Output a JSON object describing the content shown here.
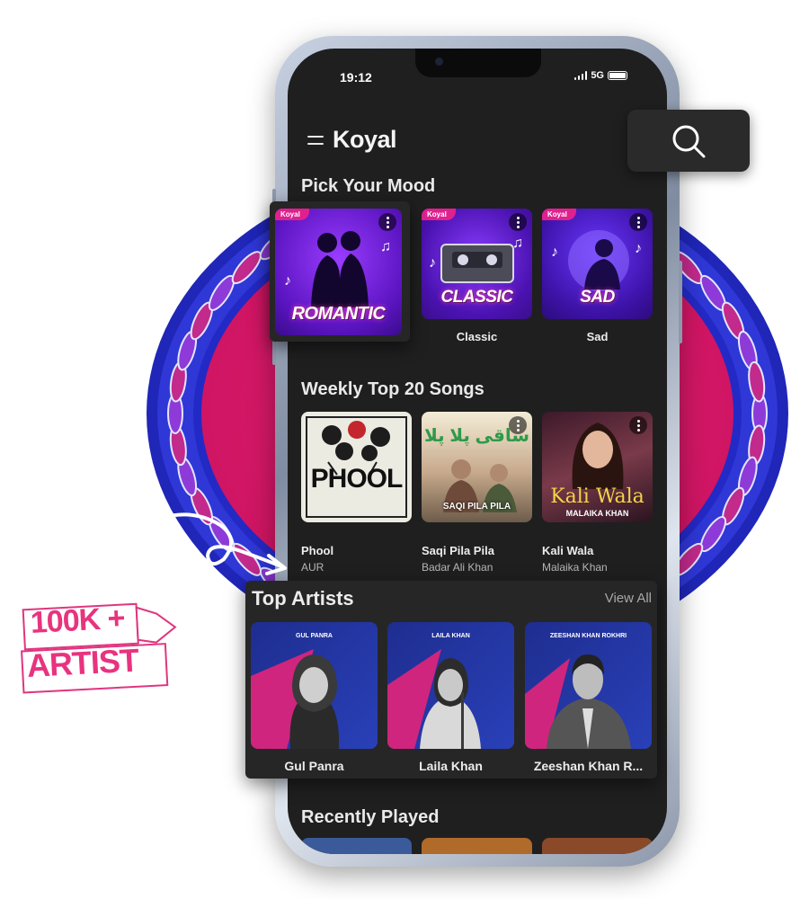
{
  "status_bar": {
    "time": "19:12",
    "network": "5G"
  },
  "app": {
    "brand": "Koyal",
    "tag": "Koyal"
  },
  "mood": {
    "title": "Pick Your Mood",
    "items": [
      {
        "art_text": "ROMANTIC",
        "label": ""
      },
      {
        "art_text": "CLASSIC",
        "label": "Classic"
      },
      {
        "art_text": "SAD",
        "label": "Sad"
      }
    ]
  },
  "weekly": {
    "title": "Weekly Top 20 Songs",
    "songs": [
      {
        "art_text": "PHOOL",
        "title": "Phool",
        "artist": "AUR"
      },
      {
        "art_text": "ساقی پلا پلا",
        "art_sub": "SAQI PILA PILA",
        "title": "Saqi Pila Pila",
        "artist": "Badar Ali Khan"
      },
      {
        "art_text": "Kali Wala",
        "art_sub": "MALAIKA KHAN",
        "title": "Kali Wala",
        "artist": "Malaika Khan"
      }
    ]
  },
  "artists": {
    "title": "Top Artists",
    "view_all": "View All",
    "items": [
      {
        "header": "GUL PANRA",
        "name": "Gul Panra"
      },
      {
        "header": "LAILA KHAN",
        "name": "Laila Khan"
      },
      {
        "header": "ZEESHAN KHAN ROKHRI",
        "name": "Zeeshan Khan R..."
      }
    ]
  },
  "recent": {
    "title": "Recently Played"
  },
  "badge": {
    "line1": "100K +",
    "line2": "ARTIST"
  },
  "colors": {
    "accent": "#e0208f",
    "background": "#1f1f1f",
    "mandala_blue": "#2a2fc8",
    "mandala_pink": "#d81b6a"
  }
}
